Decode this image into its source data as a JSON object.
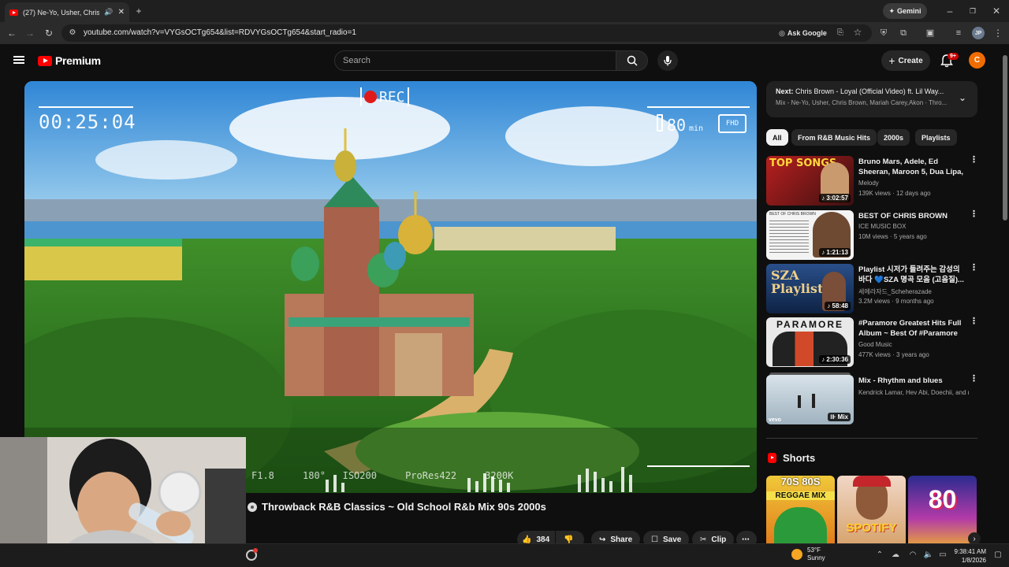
{
  "browser": {
    "tab_title": "(27) Ne-Yo, Usher, Chris Bro",
    "url": "youtube.com/watch?v=VYGsOCTg654&list=RDVYGsOCTg654&start_radio=1",
    "ask_google": "Ask Google",
    "gemini": "Gemini",
    "profile": "JP"
  },
  "header": {
    "logo": "Premium",
    "search_placeholder": "Search",
    "create_label": "Create",
    "notification_badge": "9+",
    "avatar_letter": "C"
  },
  "video": {
    "hud_timer": "00:25:04",
    "hud_rec": "REC",
    "hud_battery": "80",
    "hud_battery_unit": "min",
    "hud_quality": "FHD",
    "hud_bottom": "F1.8     180°   ISO200     ProRes422     3200K",
    "title": "Throwback R&B Classics ~ Old School R&b Mix 90s 2000s",
    "likes": "384",
    "share": "Share",
    "save": "Save",
    "clip": "Clip"
  },
  "up_next": {
    "line1_prefix": "Next:",
    "line1": "Chris Brown - Loyal (Official Video) ft. Lil Way...",
    "line2": "Mix - Ne-Yo, Usher, Chris Brown, Mariah Carey,Akon · Thro..."
  },
  "chips": [
    "All",
    "From R&B Music Hits",
    "2000s",
    "Playlists"
  ],
  "recommendations": [
    {
      "title": "Bruno Mars, Adele, Ed Sheeran, Maroon 5, Dua Lipa, Rihanna, ...",
      "channel": "Melody",
      "meta": "139K views · 12 days ago",
      "duration": "3:02:57",
      "thumb_text": "TOP SONGS"
    },
    {
      "title": "BEST OF CHRIS BROWN",
      "channel": "ICE MUSIC BOX",
      "meta": "10M views · 5 years ago",
      "duration": "1:21:13",
      "thumb_text": "BEST OF CHRIS BROWN"
    },
    {
      "title": "Playlist 시저가 들려주는 감성의 바다 💙SZA 명곡 모음 (고음질)...",
      "channel": "세에라자드_Scheherazade",
      "meta": "3.2M views · 9 months ago",
      "duration": "58:48",
      "thumb_text": "SZA Playlist"
    },
    {
      "title": "#Paramore Greatest Hits Full Album ~ Best Of #Paramore ...",
      "channel": "Good Music",
      "meta": "477K views · 3 years ago",
      "duration": "2:30:36",
      "thumb_text": "PARAMORE"
    },
    {
      "title": "Mix - Rhythm and blues",
      "channel": "Kendrick Lamar, Hev Abi, Doechii, and m...",
      "meta": "",
      "duration": "Mix",
      "thumb_text": "vevo"
    }
  ],
  "shorts": {
    "heading": "Shorts",
    "tiles": [
      {
        "label_top": "70S 80S",
        "label_bottom": "REGGAE MIX"
      },
      {
        "label_top": "",
        "label_bottom": "SPOTIFY"
      },
      {
        "label_top": "80",
        "label_bottom": ""
      }
    ]
  },
  "taskbar": {
    "temp": "53°F",
    "condition": "Sunny",
    "time": "9:38:41 AM",
    "date": "1/8/2026"
  },
  "colors": {
    "brand": "#ff0000",
    "background": "#0f0f0f",
    "chip_bg": "#272727",
    "avatar": "#ef6c00"
  }
}
